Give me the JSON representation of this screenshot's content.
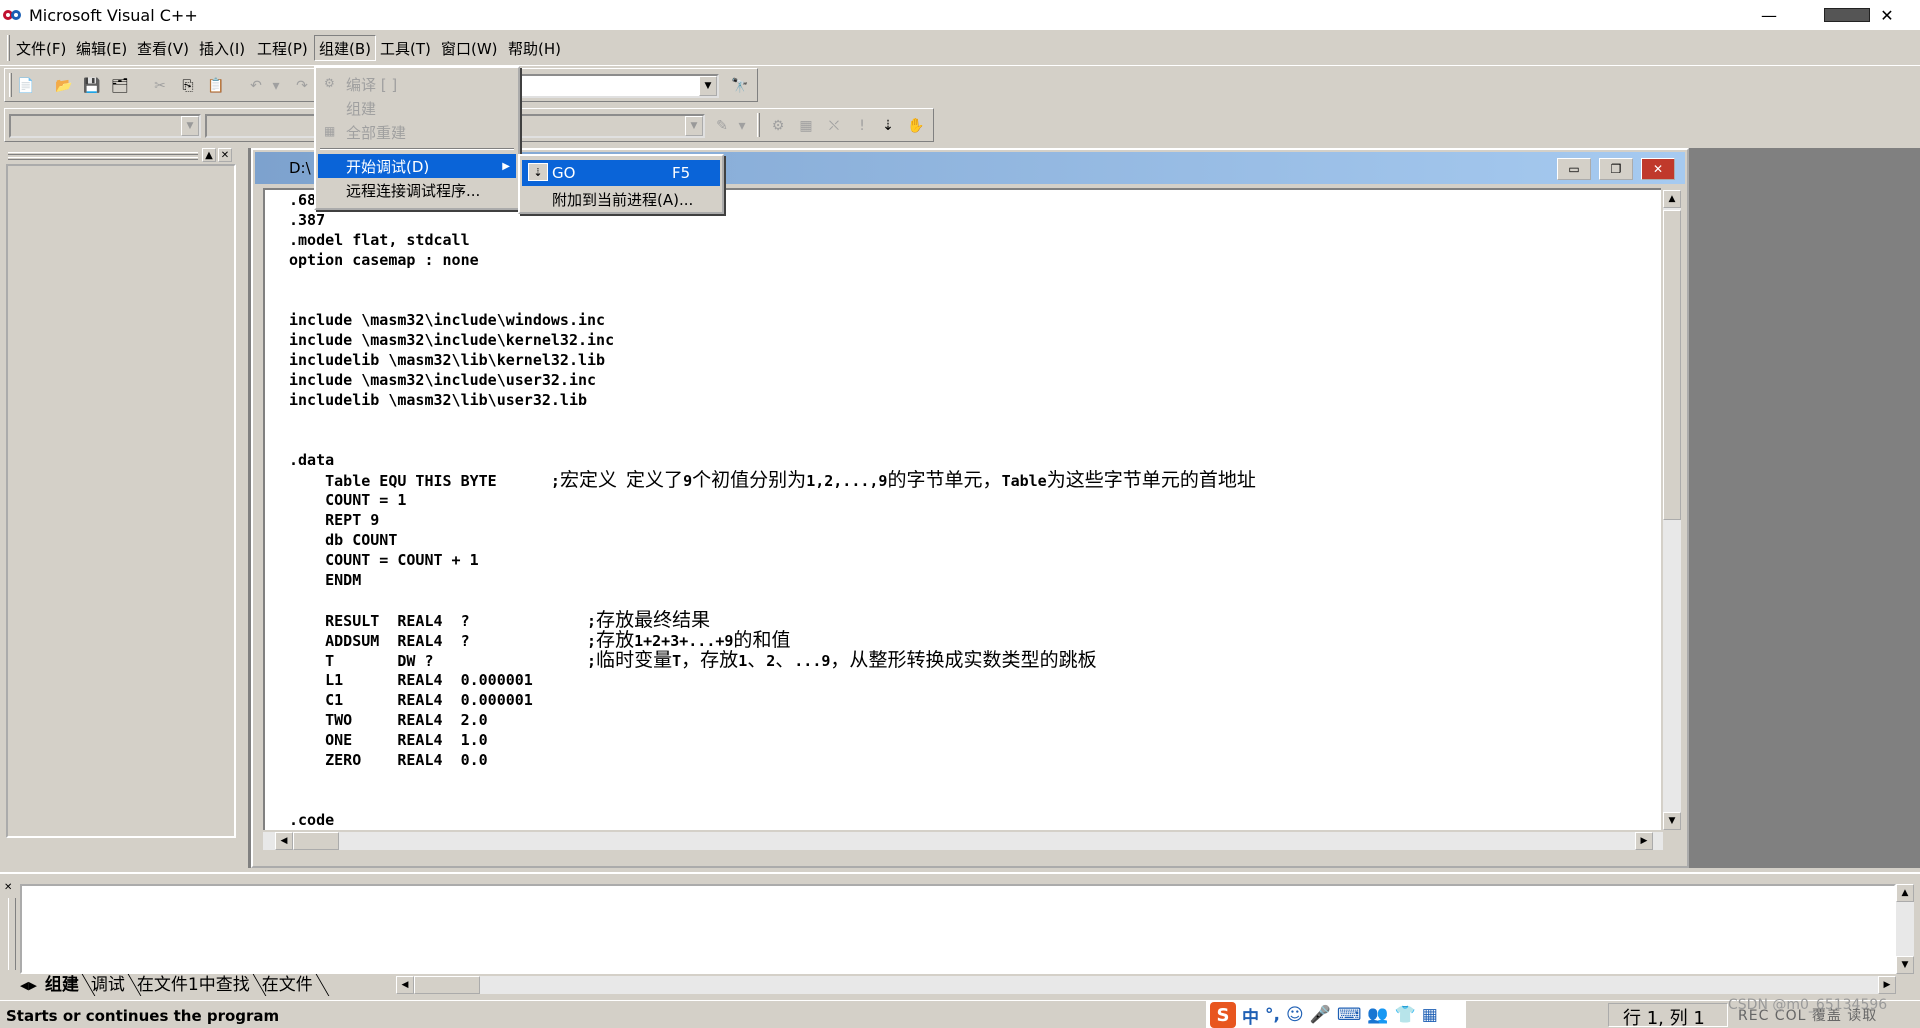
{
  "app": {
    "title": "Microsoft Visual C++"
  },
  "window_controls": {
    "minimize": "—",
    "close": "✕"
  },
  "menubar": {
    "items": [
      "文件(F)",
      "编辑(E)",
      "查看(V)",
      "插入(I)",
      "工程(P)",
      "组建(B)",
      "工具(T)",
      "窗口(W)",
      "帮助(H)"
    ],
    "active": "组建(B)"
  },
  "build_menu": {
    "items": [
      {
        "label": "编译 [ ]",
        "enabled": false,
        "icon": "compile-icon"
      },
      {
        "label": "组建",
        "enabled": false
      },
      {
        "label": "全部重建",
        "enabled": false,
        "icon": "rebuild-icon"
      },
      {
        "label": "开始调试(D)",
        "enabled": true,
        "selected": true,
        "submenu": true
      },
      {
        "label": "远程连接调试程序...",
        "enabled": true
      }
    ]
  },
  "debug_submenu": {
    "items": [
      {
        "label": "GO",
        "shortcut": "F5",
        "selected": true,
        "icon": "go-icon"
      },
      {
        "label": "附加到当前进程(A)...",
        "shortcut": ""
      }
    ]
  },
  "editor": {
    "title": "D:\\",
    "code_lines": [
      ".68",
      ".387",
      ".model flat, stdcall",
      "option casemap : none",
      "",
      "",
      "include \\masm32\\include\\windows.inc",
      "include \\masm32\\include\\kernel32.inc",
      "includelib \\masm32\\lib\\kernel32.lib",
      "include \\masm32\\include\\user32.inc",
      "includelib \\masm32\\lib\\user32.lib",
      "",
      "",
      ".data",
      "    Table EQU THIS BYTE      ;宏定义 定义了9个初值分别为1,2,...,9的字节单元，Table为这些字节单元的首地址",
      "    COUNT = 1",
      "    REPT 9",
      "    db COUNT",
      "    COUNT = COUNT + 1",
      "    ENDM",
      "",
      "    RESULT  REAL4  ?             ;存放最终结果",
      "    ADDSUM  REAL4  ?             ;存放1+2+3+...+9的和值",
      "    T       DW ?                 ;临时变量T，存放1、2、...9，从整形转换成实数类型的跳板",
      "    L1      REAL4  0.000001",
      "    C1      REAL4  0.000001",
      "    TWO     REAL4  2.0",
      "    ONE     REAL4  1.0",
      "    ZERO    REAL4  0.0",
      "",
      "",
      ".code"
    ]
  },
  "output": {
    "tabs": [
      "组建",
      "调试",
      "在文件1中查找",
      "在文件"
    ],
    "active_tab": "组建"
  },
  "statusbar": {
    "message": "Starts or continues the program",
    "position": "行 1, 列 1",
    "modes": "REC COL 覆盖 读取",
    "watermark": "CSDN @m0_65134596"
  },
  "ime": {
    "logo": "S",
    "lang": "中",
    "icons": [
      "°,",
      "☺",
      "🎤",
      "⌨",
      "👥",
      "👕",
      "▦"
    ]
  }
}
